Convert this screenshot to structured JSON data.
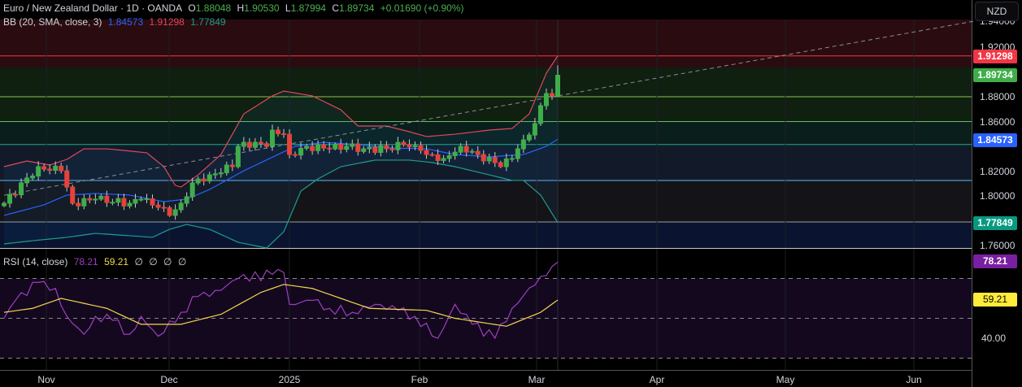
{
  "header": {
    "symbol": "Euro / New Zealand Dollar · 1D · OANDA",
    "open_label": "O",
    "open": "1.88048",
    "high_label": "H",
    "high": "1.90530",
    "low_label": "L",
    "low": "1.87994",
    "close_label": "C",
    "close": "1.89734",
    "change": "+0.01690 (+0.90%)",
    "bb_label": "BB (20, SMA, close, 3)",
    "bb_basis": "1.84573",
    "bb_upper": "1.91298",
    "bb_lower": "1.77849"
  },
  "rsi_legend": {
    "label": "RSI (14, close)",
    "rsi": "78.21",
    "ma": "59.21",
    "extras": [
      "∅",
      "∅",
      "∅",
      "∅"
    ]
  },
  "currency_button": "NZD",
  "price_axis": [
    "1.94000",
    "1.92000",
    "1.88000",
    "1.86000",
    "1.82000",
    "1.80000",
    "1.76000"
  ],
  "price_tags": {
    "upper": "1.91298",
    "last": "1.89734",
    "basis": "1.84573",
    "lower": "1.77849"
  },
  "rsi_axis": [
    "40.00"
  ],
  "rsi_tags": {
    "rsi": "78.21",
    "ma": "59.21"
  },
  "time_axis": [
    "Nov",
    "Dec",
    "2025",
    "Feb",
    "Mar",
    "Apr",
    "May",
    "Jun"
  ],
  "colors": {
    "up": "#3fae4a",
    "down": "#e5433a",
    "bb_upper": "#e0475a",
    "bb_basis": "#2962ff",
    "bb_lower": "#1f9e89",
    "rsi": "#9c3fc0",
    "rsi_ma": "#f2d94e",
    "tag_last": "#3fae4a",
    "tag_upper": "#f23645",
    "tag_basis": "#2962ff",
    "tag_lower": "#089981",
    "tag_rsi": "#7b1fa2",
    "tag_ma": "#ffeb3b"
  },
  "chart_data": {
    "type": "candlestick",
    "symbol": "EURNZD",
    "interval": "1D",
    "bars": 98,
    "price_ylim": [
      1.76,
      1.94
    ],
    "close_anchors": [
      [
        0,
        1.7941
      ],
      [
        6,
        1.8236
      ],
      [
        10,
        1.8203
      ],
      [
        11,
        1.8072
      ],
      [
        12,
        1.7941
      ],
      [
        16,
        1.7974
      ],
      [
        22,
        1.7941
      ],
      [
        24,
        1.7974
      ],
      [
        27,
        1.7908
      ],
      [
        29,
        1.7843
      ],
      [
        31,
        1.7941
      ],
      [
        33,
        1.8105
      ],
      [
        36,
        1.817
      ],
      [
        40,
        1.8236
      ],
      [
        41,
        1.84
      ],
      [
        44,
        1.8433
      ],
      [
        46,
        1.84
      ],
      [
        47,
        1.8531
      ],
      [
        49,
        1.8498
      ],
      [
        50,
        1.8334
      ],
      [
        53,
        1.84
      ],
      [
        57,
        1.838
      ],
      [
        60,
        1.84
      ],
      [
        63,
        1.838
      ],
      [
        67,
        1.838
      ],
      [
        70,
        1.8413
      ],
      [
        73,
        1.8367
      ],
      [
        74,
        1.8334
      ],
      [
        77,
        1.8302
      ],
      [
        80,
        1.84
      ],
      [
        83,
        1.8334
      ],
      [
        86,
        1.8269
      ],
      [
        87,
        1.8236
      ],
      [
        89,
        1.8302
      ],
      [
        90,
        1.838
      ],
      [
        91,
        1.8452
      ],
      [
        93,
        1.8584
      ],
      [
        94,
        1.8728
      ],
      [
        95,
        1.8826
      ],
      [
        96,
        1.8805
      ],
      [
        97,
        1.89734
      ]
    ],
    "last_bar": {
      "open": 1.88048,
      "high": 1.9053,
      "low": 1.87994,
      "close": 1.89734
    },
    "bollinger": {
      "upper": [
        [
          0,
          1.8236
        ],
        [
          4,
          1.8282
        ],
        [
          8,
          1.8249
        ],
        [
          11,
          1.8295
        ],
        [
          14,
          1.838
        ],
        [
          18,
          1.838
        ],
        [
          21,
          1.8367
        ],
        [
          25,
          1.8348
        ],
        [
          28,
          1.8236
        ],
        [
          30,
          1.8085
        ],
        [
          31,
          1.8072
        ],
        [
          34,
          1.817
        ],
        [
          38,
          1.8334
        ],
        [
          42,
          1.8662
        ],
        [
          47,
          1.8807
        ],
        [
          49,
          1.8846
        ],
        [
          54,
          1.8807
        ],
        [
          59,
          1.8695
        ],
        [
          62,
          1.8564
        ],
        [
          67,
          1.8564
        ],
        [
          71,
          1.8518
        ],
        [
          74,
          1.8479
        ],
        [
          79,
          1.8498
        ],
        [
          85,
          1.8531
        ],
        [
          89,
          1.8544
        ],
        [
          92,
          1.8662
        ],
        [
          95,
          1.899
        ],
        [
          97,
          1.91298
        ]
      ],
      "basis": [
        [
          0,
          1.7843
        ],
        [
          7,
          1.7928
        ],
        [
          11,
          1.8007
        ],
        [
          16,
          1.802
        ],
        [
          22,
          1.8007
        ],
        [
          28,
          1.7954
        ],
        [
          32,
          1.7974
        ],
        [
          36,
          1.8052
        ],
        [
          42,
          1.8203
        ],
        [
          48,
          1.8334
        ],
        [
          51,
          1.84
        ],
        [
          56,
          1.8433
        ],
        [
          62,
          1.8413
        ],
        [
          68,
          1.8387
        ],
        [
          74,
          1.838
        ],
        [
          79,
          1.8334
        ],
        [
          85,
          1.8315
        ],
        [
          91,
          1.8334
        ],
        [
          95,
          1.84
        ],
        [
          97,
          1.84573
        ]
      ],
      "lower": [
        [
          0,
          1.7613
        ],
        [
          5,
          1.7639
        ],
        [
          11,
          1.7666
        ],
        [
          16,
          1.7698
        ],
        [
          22,
          1.7679
        ],
        [
          26,
          1.7666
        ],
        [
          29,
          1.7731
        ],
        [
          32,
          1.777
        ],
        [
          36,
          1.7731
        ],
        [
          41,
          1.7626
        ],
        [
          46,
          1.758
        ],
        [
          49,
          1.7711
        ],
        [
          52,
          1.8039
        ],
        [
          55,
          1.8138
        ],
        [
          59,
          1.8236
        ],
        [
          65,
          1.8289
        ],
        [
          71,
          1.8289
        ],
        [
          75,
          1.8269
        ],
        [
          79,
          1.8236
        ],
        [
          85,
          1.817
        ],
        [
          89,
          1.8125
        ],
        [
          91,
          1.8125
        ],
        [
          94,
          1.8007
        ],
        [
          97,
          1.77849
        ]
      ]
    },
    "levels": [
      1.91298,
      1.88,
      1.86,
      1.8415,
      1.8125,
      1.779
    ],
    "trendline": [
      [
        0,
        1.8006
      ],
      [
        170,
        1.941
      ]
    ],
    "rsi": {
      "ylim": [
        26,
        82
      ],
      "bands": [
        70,
        50,
        30
      ],
      "values": [
        [
          0,
          50
        ],
        [
          2,
          59
        ],
        [
          6,
          68
        ],
        [
          8,
          64
        ],
        [
          9,
          65
        ],
        [
          11,
          51
        ],
        [
          14,
          42
        ],
        [
          16,
          51
        ],
        [
          19,
          49
        ],
        [
          22,
          42
        ],
        [
          24,
          51
        ],
        [
          27,
          41
        ],
        [
          31,
          53
        ],
        [
          34,
          61
        ],
        [
          36,
          61
        ],
        [
          41,
          70
        ],
        [
          47,
          72
        ],
        [
          49,
          73
        ],
        [
          50,
          57
        ],
        [
          54,
          59
        ],
        [
          57,
          55
        ],
        [
          61,
          53
        ],
        [
          65,
          57
        ],
        [
          69,
          54
        ],
        [
          72,
          51
        ],
        [
          76,
          40
        ],
        [
          79,
          57
        ],
        [
          82,
          47
        ],
        [
          86,
          40
        ],
        [
          89,
          55
        ],
        [
          94,
          71
        ],
        [
          96,
          76
        ],
        [
          97,
          78.21
        ]
      ],
      "ma": [
        [
          0,
          53
        ],
        [
          5,
          55
        ],
        [
          10,
          60
        ],
        [
          18,
          55
        ],
        [
          24,
          47
        ],
        [
          31,
          47
        ],
        [
          38,
          52
        ],
        [
          45,
          63
        ],
        [
          49,
          67
        ],
        [
          54,
          65
        ],
        [
          64,
          55
        ],
        [
          74,
          54
        ],
        [
          79,
          50
        ],
        [
          88,
          46
        ],
        [
          94,
          53
        ],
        [
          97,
          59.21
        ]
      ]
    }
  }
}
